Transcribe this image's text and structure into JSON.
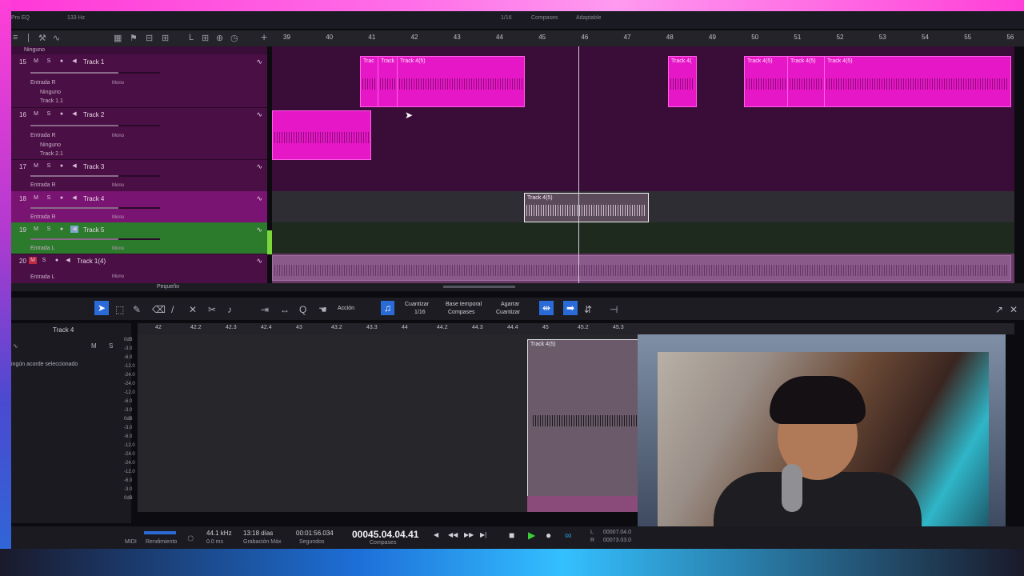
{
  "top_strip": {
    "left_label": "Pro EQ",
    "freq": "133 Hz",
    "quantize": "1/16",
    "timebase": "Compases",
    "snap": "Adaptable"
  },
  "toolbar": {
    "group_label": "Ninguno"
  },
  "ruler_bars": [
    "39",
    "40",
    "41",
    "42",
    "43",
    "44",
    "45",
    "46",
    "47",
    "48",
    "49",
    "50",
    "51",
    "52",
    "53",
    "54",
    "55",
    "56"
  ],
  "tracks": [
    {
      "num": "15",
      "name": "Track 1",
      "input": "Entrada R",
      "mode": "Mono",
      "row2": "Ninguno",
      "row3": "Track 1.1"
    },
    {
      "num": "16",
      "name": "Track 2",
      "input": "Entrada R",
      "mode": "Mono",
      "row2": "Ninguno",
      "row3": "Track 2.1"
    },
    {
      "num": "17",
      "name": "Track 3",
      "input": "Entrada R",
      "mode": "Mono"
    },
    {
      "num": "18",
      "name": "Track 4",
      "input": "Entrada R",
      "mode": "Mono"
    },
    {
      "num": "19",
      "name": "Track 5",
      "input": "Entrada L",
      "mode": "Mono"
    },
    {
      "num": "20",
      "name": "Track 1(4)",
      "input": "Entrada L",
      "mode": "Mono"
    }
  ],
  "clips": {
    "track1": [
      "Trac",
      "Track",
      "Track 4(5)",
      "Track 4(",
      "Track 4(5)",
      "Track 4(5)",
      "Track 4(5)"
    ],
    "track4": "Track 4(5)",
    "editor": "Track 4(5)"
  },
  "zoom_label": "Pequeño",
  "editor": {
    "track_name": "Track 4",
    "action_label": "Acción",
    "quantize_title": "Cuantizar",
    "quantize_value": "1/16",
    "timebase_title": "Base temporal",
    "timebase_value": "Compases",
    "snap_title": "Agarrar",
    "snap_value": "Cuantizar",
    "chord_note": "ingún acorde seleccionado",
    "m_label": "M",
    "s_label": "S",
    "ruler": [
      "42",
      "42.2",
      "42.3",
      "42.4",
      "43",
      "43.2",
      "43.3",
      "44",
      "44.2",
      "44.3",
      "44.4",
      "45",
      "45.2",
      "45.3"
    ],
    "db_scale": [
      "0dB",
      "-3.0",
      "-6.0",
      "-12.0",
      "-24.0",
      "-24.0",
      "-12.0",
      "-6.0",
      "-3.0",
      "0dB",
      "-3.0",
      "-6.0",
      "-12.0",
      "-24.0",
      "-24.0",
      "-12.0",
      "-6.0",
      "-3.0",
      "0dB"
    ]
  },
  "transport": {
    "midi_label": "MIDI",
    "perf_label": "Rendimiento",
    "sample_rate": "44.1 kHz",
    "latency": "0.0 ms",
    "rec_time": "13:18 días",
    "rec_label": "Grabación Máx",
    "seconds": "00:01:56.034",
    "seconds_label": "Segundos",
    "bars": "00045.04.04.41",
    "bars_label": "Compases",
    "left_pos": "00007.04.0",
    "right_pos": "00073.03.0",
    "l_label": "L",
    "r_label": "R"
  },
  "colors": {
    "clip": "#e617c7",
    "track_bg": "#4a0f45",
    "active_track": "#2c7a2c",
    "accent": "#2a6bd8"
  }
}
